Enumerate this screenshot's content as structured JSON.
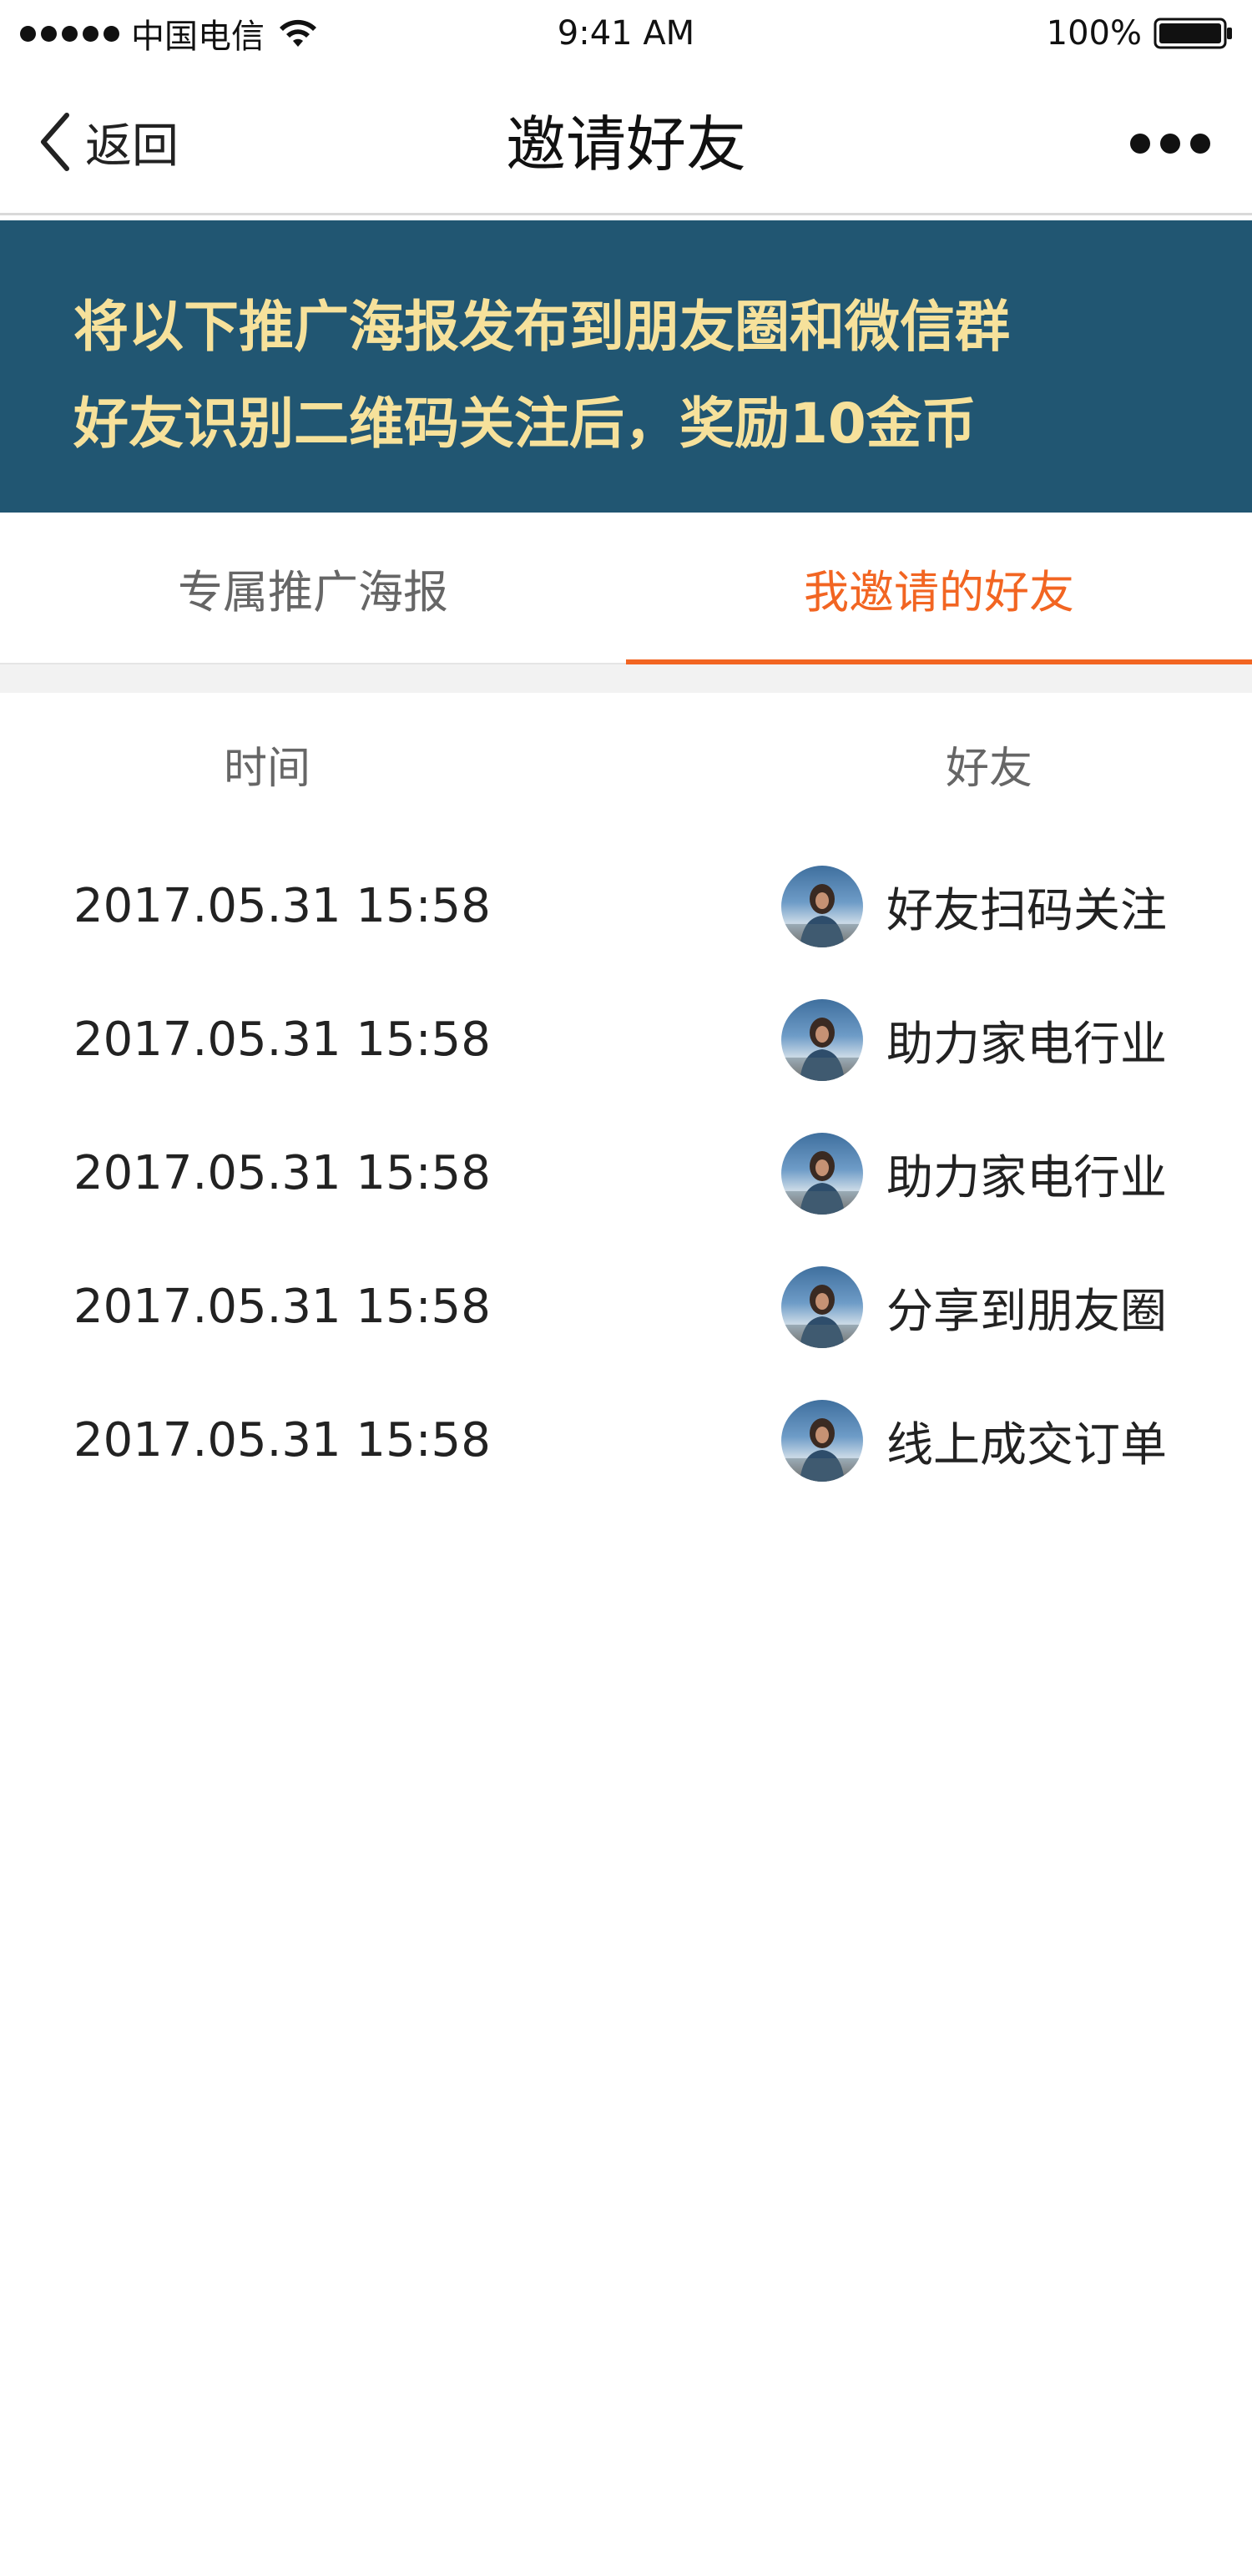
{
  "status_bar": {
    "carrier": "中国电信",
    "time": "9:41 AM",
    "battery": "100%"
  },
  "nav": {
    "back_label": "返回",
    "title": "邀请好友"
  },
  "banner": {
    "line1": "将以下推广海报发布到朋友圈和微信群",
    "line2": "好友识别二维码关注后，奖励10金币"
  },
  "tabs": [
    {
      "label": "专属推广海报",
      "active": false
    },
    {
      "label": "我邀请的好友",
      "active": true
    }
  ],
  "table": {
    "header_time": "时间",
    "header_friend": "好友",
    "rows": [
      {
        "time": "2017.05.31 15:58",
        "friend": "好友扫码关注"
      },
      {
        "time": "2017.05.31 15:58",
        "friend": "助力家电行业"
      },
      {
        "time": "2017.05.31 15:58",
        "friend": "助力家电行业"
      },
      {
        "time": "2017.05.31 15:58",
        "friend": "分享到朋友圈"
      },
      {
        "time": "2017.05.31 15:58",
        "friend": "线上成交订单"
      }
    ]
  },
  "colors": {
    "banner_bg": "#215672",
    "banner_text": "#f6e19b",
    "accent": "#f26522"
  }
}
